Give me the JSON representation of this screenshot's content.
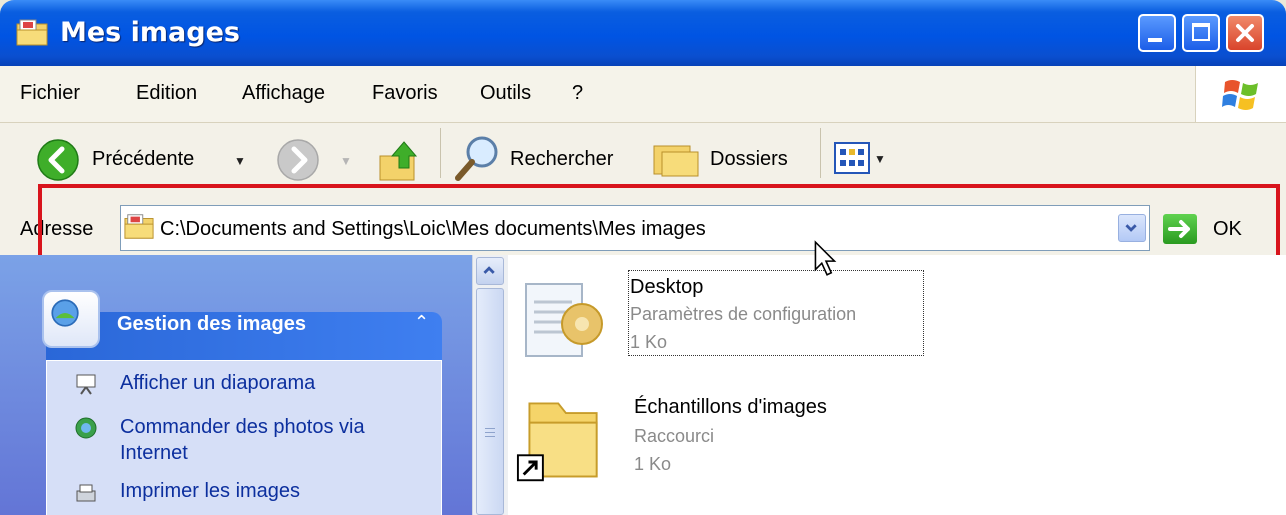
{
  "window": {
    "title": "Mes images"
  },
  "menu": {
    "items": [
      "Fichier",
      "Edition",
      "Affichage",
      "Favoris",
      "Outils",
      "?"
    ]
  },
  "toolbar": {
    "back_label": "Précédente",
    "search_label": "Rechercher",
    "folders_label": "Dossiers"
  },
  "address": {
    "label": "Adresse",
    "path": "C:\\Documents and Settings\\Loic\\Mes documents\\Mes images",
    "go_label": "OK"
  },
  "task_pane": {
    "title": "Gestion des images",
    "tasks": [
      {
        "label": "Afficher un diaporama",
        "icon": "slideshow-icon"
      },
      {
        "label": "Commander des photos via",
        "label2": "Internet",
        "icon": "globe-icon"
      },
      {
        "label": "Imprimer les images",
        "icon": "printer-icon"
      }
    ]
  },
  "files": [
    {
      "name": "Desktop",
      "type": "Paramètres de configuration",
      "size": "1 Ko"
    },
    {
      "name": "Échantillons d'images",
      "type": "Raccourci",
      "size": "1 Ko"
    }
  ],
  "colors": {
    "title_bar": "#0054e3",
    "highlight_border": "#d8141c",
    "task_link": "#0c2f9e"
  }
}
